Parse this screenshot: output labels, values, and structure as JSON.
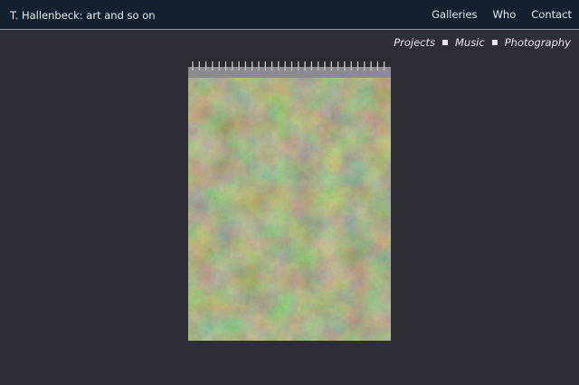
{
  "header": {
    "site_title": "T. Hallenbeck: art and so on",
    "nav": [
      "Galleries",
      "Who",
      "Contact"
    ]
  },
  "subnav": {
    "items": [
      "Projects",
      "Music",
      "Photography"
    ]
  },
  "colors": {
    "page_background": "#2e2e37",
    "header_background": "#14202d",
    "text": "#e6e8ec"
  }
}
